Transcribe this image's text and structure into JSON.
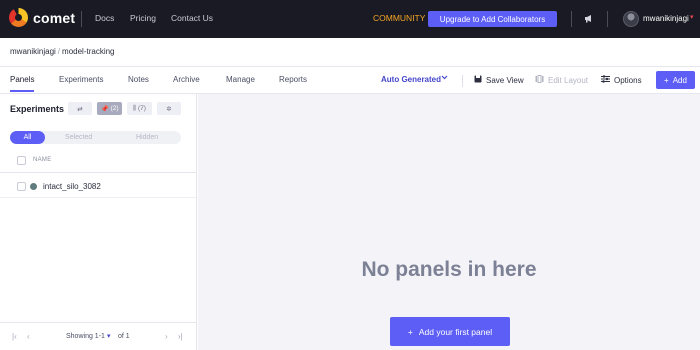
{
  "app": {
    "name": "comet"
  },
  "topnav": {
    "links": [
      "Docs",
      "Pricing",
      "Contact Us"
    ],
    "community": "COMMUNITY",
    "upgrade_label": "Upgrade to Add Collaborators",
    "username": "mwanikinjagi"
  },
  "breadcrumb": {
    "workspace": "mwanikinjagi",
    "separator": "/",
    "project": "model-tracking"
  },
  "tabs": [
    {
      "label": "Panels",
      "active": true
    },
    {
      "label": "Experiments",
      "active": false
    },
    {
      "label": "Notes",
      "active": false
    },
    {
      "label": "Archive",
      "active": false
    },
    {
      "label": "Manage",
      "active": false
    },
    {
      "label": "Reports",
      "active": false
    }
  ],
  "toolbar": {
    "view_select": "Auto Generated",
    "save_view": "Save View",
    "edit_layout": "Edit Layout",
    "options": "Options",
    "add": "Add"
  },
  "experiments_panel": {
    "title": "Experiments",
    "pinned_count": "(2)",
    "column_count": "(7)",
    "filters": [
      "All",
      "Selected",
      "Hidden"
    ],
    "column_header": "NAME",
    "rows": [
      {
        "name": "intact_silo_3082",
        "status_color": "#5f7b7d"
      }
    ],
    "pagination": {
      "showing": "Showing 1-1",
      "of": "of 1"
    }
  },
  "main": {
    "empty_title": "No panels in here",
    "add_first_panel": "Add your first panel"
  },
  "colors": {
    "accent": "#5c5ef5",
    "nav_bg": "#191a23",
    "community": "#f5a524"
  }
}
